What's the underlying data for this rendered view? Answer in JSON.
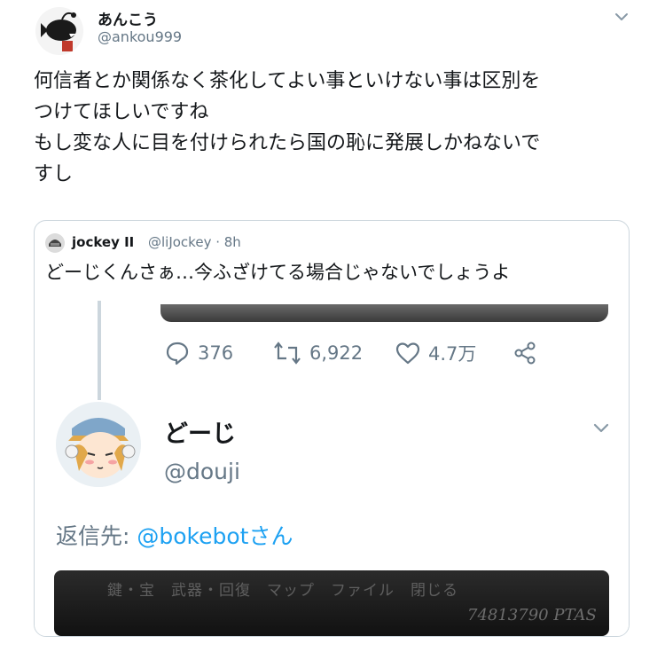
{
  "tweet": {
    "display_name": "あんこう",
    "handle": "@ankou999",
    "text": "何信者とか関係なく茶化してよい事といけない事は区別を\nつけてほしいですね\nもし変な人に目を付けられたら国の恥に発展しかねないで\nすし"
  },
  "quote": {
    "display_name": "jockey II",
    "handle_time": "@liJockey · 8h",
    "text": "どーじくんさぁ…今ふざけてる場合じゃないでしょうよ",
    "screenshot": {
      "reply_count": "376",
      "retweet_count": "6,922",
      "like_count": "4.7万",
      "reply_author_name": "どーじ",
      "reply_author_handle": "@douji",
      "reply_to_prefix": "返信先: ",
      "reply_to_user": "@bokebotさん",
      "game_menu": "鍵・宝　武器・回復　マップ　ファイル　閉じる",
      "game_money": "74813790 PTAS"
    }
  },
  "colors": {
    "link": "#1da1f2",
    "secondary_text": "#657786",
    "border": "#ccd6dd"
  }
}
